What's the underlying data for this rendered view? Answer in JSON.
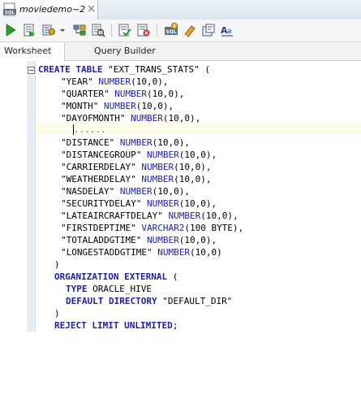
{
  "tab": {
    "title": "moviedemo~2"
  },
  "toolbar": {
    "icons": [
      "run-statement-icon",
      "run-script-icon",
      "autotrace-icon",
      "explain-plan-icon",
      "sql-tuning-icon",
      "commit-icon",
      "rollback-icon",
      "sql-history-icon",
      "clear-icon",
      "format-icon",
      "case-toggle-icon"
    ]
  },
  "subtabs": {
    "worksheet": "Worksheet",
    "query_builder": "Query Builder"
  },
  "code": {
    "l1_kw": "CREATE TABLE",
    "l1_str": " \"EXT_TRANS_STATS\" (",
    "cols": [
      {
        "name": "\"YEAR\"",
        "type": "NUMBER",
        "args": "(10,0),"
      },
      {
        "name": "\"QUARTER\"",
        "type": "NUMBER",
        "args": "(10,0),"
      },
      {
        "name": "\"MONTH\"",
        "type": "NUMBER",
        "args": "(10,0),"
      },
      {
        "name": "\"DAYOFMONTH\"",
        "type": "NUMBER",
        "args": "(10,0),"
      },
      {
        "name": "\"DISTANCE\"",
        "type": "NUMBER",
        "args": "(10,0),"
      },
      {
        "name": "\"DISTANCEGROUP\"",
        "type": "NUMBER",
        "args": "(10,0),"
      },
      {
        "name": "\"CARRIERDELAY\"",
        "type": "NUMBER",
        "args": "(10,0),"
      },
      {
        "name": "\"WEATHERDELAY\"",
        "type": "NUMBER",
        "args": "(10,0),"
      },
      {
        "name": "\"NASDELAY\"",
        "type": "NUMBER",
        "args": "(10,0),"
      },
      {
        "name": "\"SECURITYDELAY\"",
        "type": "NUMBER",
        "args": "(10,0),"
      },
      {
        "name": "\"LATEAIRCRAFTDELAY\"",
        "type": "NUMBER",
        "args": "(10,0),"
      },
      {
        "name": "\"FIRSTDEPTIME\"",
        "type": "VARCHAR2",
        "args": "(100 BYTE),"
      },
      {
        "name": "\"TOTALADDGTIME\"",
        "type": "NUMBER",
        "args": "(10,0),"
      },
      {
        "name": "\"LONGESTADDGTIME\"",
        "type": "NUMBER",
        "args": "(10,0)"
      }
    ],
    "dots": "......",
    "close1": ")",
    "org_kw": "ORGANIZATION EXTERNAL",
    "org_rest": " (",
    "type_kw": "TYPE",
    "type_val": " ORACLE_HIVE",
    "dir_kw": "DEFAULT DIRECTORY",
    "dir_val": " \"DEFAULT_DIR\"",
    "close2": ")",
    "reject_kw": "REJECT LIMIT UNLIMITED",
    "reject_end": ";"
  }
}
